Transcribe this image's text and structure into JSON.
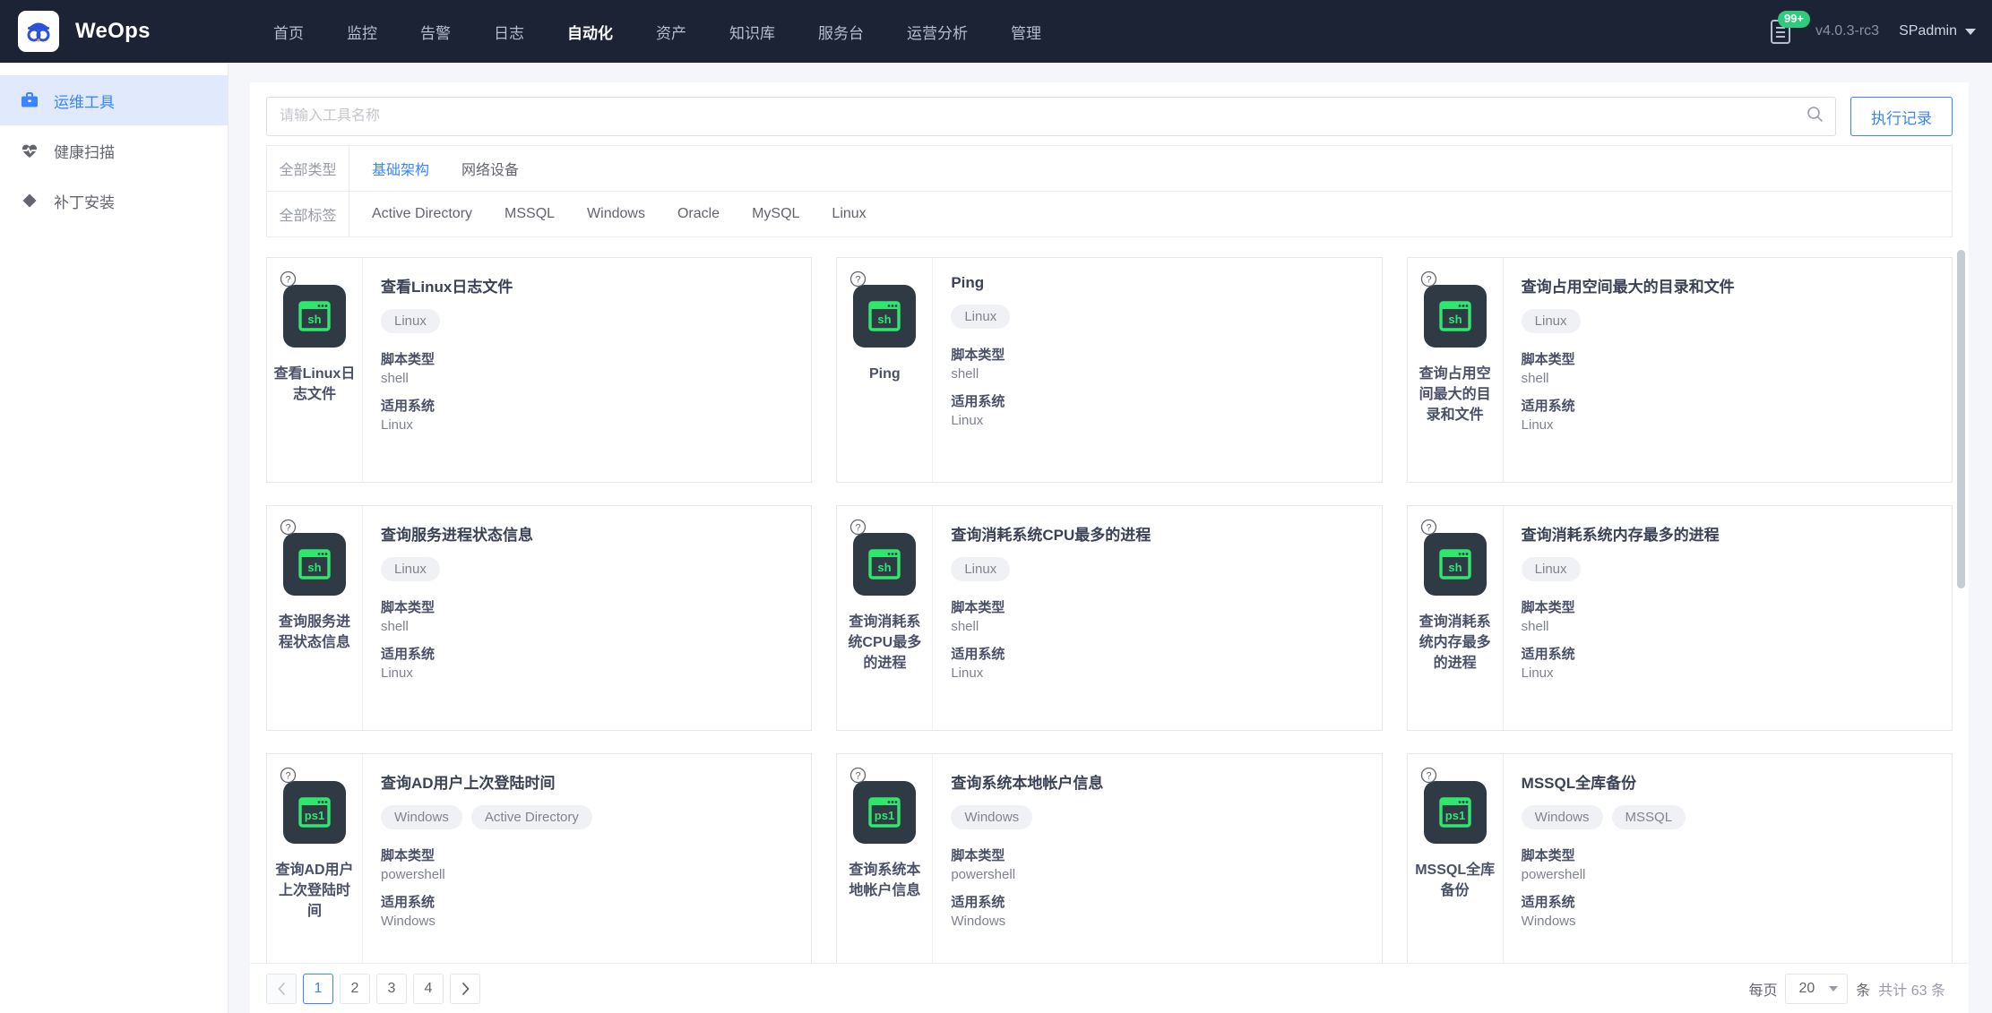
{
  "header": {
    "brand": "WeOps",
    "logo_icon": "weops-infinity-logo",
    "nav": [
      {
        "label": "首页",
        "active": false
      },
      {
        "label": "监控",
        "active": false
      },
      {
        "label": "告警",
        "active": false
      },
      {
        "label": "日志",
        "active": false
      },
      {
        "label": "自动化",
        "active": true
      },
      {
        "label": "资产",
        "active": false
      },
      {
        "label": "知识库",
        "active": false
      },
      {
        "label": "服务台",
        "active": false
      },
      {
        "label": "运营分析",
        "active": false
      },
      {
        "label": "管理",
        "active": false
      }
    ],
    "notification": {
      "icon": "clipboard-list-icon",
      "badge": "99+"
    },
    "version": "v4.0.3-rc3",
    "user": "SPadmin",
    "user_caret_icon": "caret-down-icon"
  },
  "sidebar": {
    "items": [
      {
        "label": "运维工具",
        "icon": "briefcase-icon",
        "active": true
      },
      {
        "label": "健康扫描",
        "icon": "heart-pulse-icon",
        "active": false
      },
      {
        "label": "补丁安装",
        "icon": "diamond-icon",
        "active": false
      }
    ]
  },
  "search": {
    "placeholder": "请输入工具名称",
    "value": "",
    "icon": "search-icon",
    "exec_records_button": "执行记录"
  },
  "filters": [
    {
      "label": "全部类型",
      "items": [
        {
          "label": "基础架构",
          "active": true
        },
        {
          "label": "网络设备",
          "active": false
        }
      ]
    },
    {
      "label": "全部标签",
      "items": [
        {
          "label": "Active Directory",
          "active": false
        },
        {
          "label": "MSSQL",
          "active": false
        },
        {
          "label": "Windows",
          "active": false
        },
        {
          "label": "Oracle",
          "active": false
        },
        {
          "label": "MySQL",
          "active": false
        },
        {
          "label": "Linux",
          "active": false
        }
      ]
    }
  ],
  "card_fields": {
    "script_type_label": "脚本类型",
    "os_label": "适用系统",
    "help_icon": "question-circle-icon"
  },
  "cards": [
    {
      "name": "查看Linux日志文件",
      "title": "查看Linux日志文件",
      "icon_text": "sh",
      "icon": "shell-terminal-icon",
      "tags": [
        "Linux"
      ],
      "script_type": "shell",
      "os": "Linux"
    },
    {
      "name": "Ping",
      "title": "Ping",
      "icon_text": "sh",
      "icon": "shell-terminal-icon",
      "tags": [
        "Linux"
      ],
      "script_type": "shell",
      "os": "Linux"
    },
    {
      "name": "查询占用空间最大的目录和文件",
      "title": "查询占用空间最大的目录和文件",
      "icon_text": "sh",
      "icon": "shell-terminal-icon",
      "tags": [
        "Linux"
      ],
      "script_type": "shell",
      "os": "Linux"
    },
    {
      "name": "查询服务进程状态信息",
      "title": "查询服务进程状态信息",
      "icon_text": "sh",
      "icon": "shell-terminal-icon",
      "tags": [
        "Linux"
      ],
      "script_type": "shell",
      "os": "Linux"
    },
    {
      "name": "查询消耗系统CPU最多的进程",
      "title": "查询消耗系统CPU最多的进程",
      "icon_text": "sh",
      "icon": "shell-terminal-icon",
      "tags": [
        "Linux"
      ],
      "script_type": "shell",
      "os": "Linux"
    },
    {
      "name": "查询消耗系统内存最多的进程",
      "title": "查询消耗系统内存最多的进程",
      "icon_text": "sh",
      "icon": "shell-terminal-icon",
      "tags": [
        "Linux"
      ],
      "script_type": "shell",
      "os": "Linux"
    },
    {
      "name": "查询AD用户上次登陆时间",
      "title": "查询AD用户上次登陆时间",
      "icon_text": "ps1",
      "icon": "powershell-terminal-icon",
      "tags": [
        "Windows",
        "Active Directory"
      ],
      "script_type": "powershell",
      "os": "Windows"
    },
    {
      "name": "查询系统本地帐户信息",
      "title": "查询系统本地帐户信息",
      "icon_text": "ps1",
      "icon": "powershell-terminal-icon",
      "tags": [
        "Windows"
      ],
      "script_type": "powershell",
      "os": "Windows"
    },
    {
      "name": "MSSQL全库备份",
      "title": "MSSQL全库备份",
      "icon_text": "ps1",
      "icon": "powershell-terminal-icon",
      "tags": [
        "Windows",
        "MSSQL"
      ],
      "script_type": "powershell",
      "os": "Windows"
    }
  ],
  "pagination": {
    "prev_icon": "chevron-left-icon",
    "next_icon": "chevron-right-icon",
    "pages": [
      "1",
      "2",
      "3",
      "4"
    ],
    "current_page": "1",
    "per_page_label": "每页",
    "page_size": "20",
    "unit_label": "条",
    "total_label": "共计 63 条"
  },
  "colors": {
    "header_bg": "#1b2334",
    "accent": "#3a84ff",
    "badge_green": "#2dcb7b",
    "icon_tile": "#2f3a45",
    "icon_green": "#2ee86e",
    "page_bg": "#f4f6fa"
  }
}
